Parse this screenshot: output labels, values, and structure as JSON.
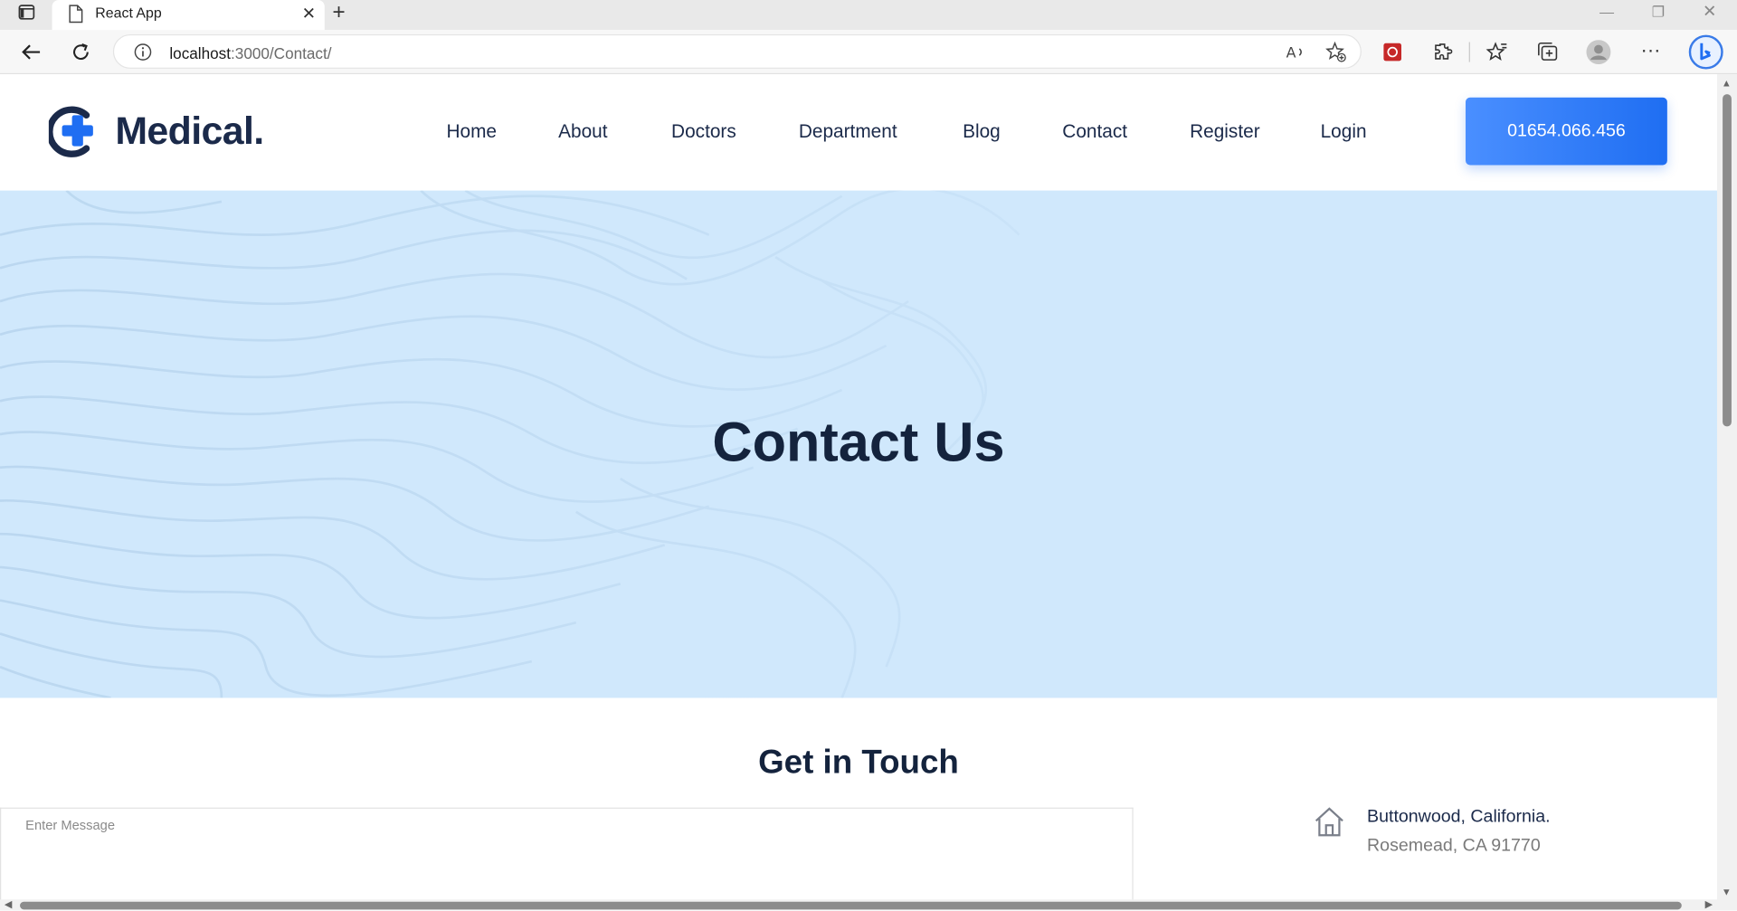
{
  "browser": {
    "tab_title": "React App",
    "url_host": "localhost",
    "url_path": ":3000/Contact/"
  },
  "header": {
    "logo_text": "Medical.",
    "nav": [
      "Home",
      "About",
      "Doctors",
      "Department",
      "Blog",
      "Contact",
      "Register",
      "Login"
    ],
    "phone": "01654.066.456"
  },
  "hero": {
    "title": "Contact Us"
  },
  "contact": {
    "section_title": "Get in Touch",
    "message_placeholder": "Enter Message",
    "address_line1": "Buttonwood, California.",
    "address_line2": "Rosemead, CA 91770"
  },
  "colors": {
    "primary": "#1f6ef2",
    "heading": "#14233d",
    "hero_bg": "#d0e8fc"
  }
}
